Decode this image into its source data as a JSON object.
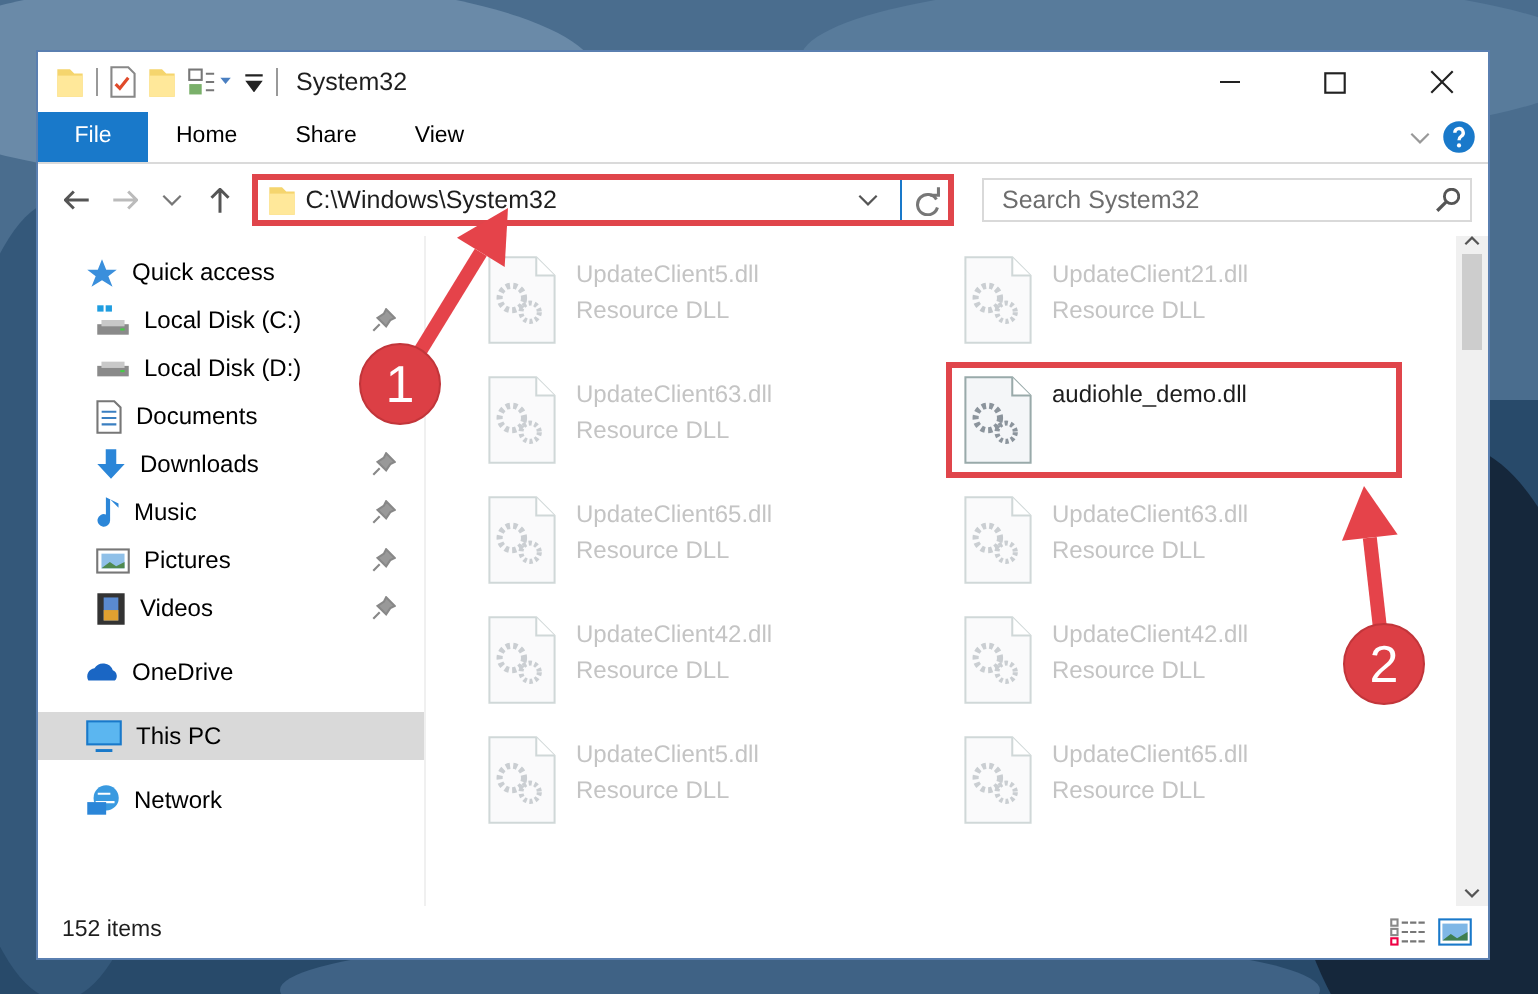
{
  "window": {
    "title": "System32"
  },
  "ribbon_tabs": [
    {
      "label": "File",
      "kind": "menu"
    },
    {
      "label": "Home",
      "kind": "tab"
    },
    {
      "label": "Share",
      "kind": "tab"
    },
    {
      "label": "View",
      "kind": "tab"
    }
  ],
  "address_bar": {
    "path": "C:\\Windows\\System32",
    "highlighted": true
  },
  "search": {
    "placeholder": "Search System32"
  },
  "sidebar": {
    "items": [
      {
        "label": "Quick access",
        "kind": "quick-access",
        "selected": false,
        "children": [
          {
            "label": "Local Disk (C:)",
            "kind": "system-drive",
            "pinned": true,
            "selected": false
          },
          {
            "label": "Local Disk (D:)",
            "kind": "drive",
            "pinned": false,
            "selected": false
          },
          {
            "label": "Documents",
            "kind": "documents",
            "pinned": false,
            "selected": false
          },
          {
            "label": "Downloads",
            "kind": "downloads",
            "pinned": true,
            "selected": false
          },
          {
            "label": "Music",
            "kind": "music",
            "pinned": true,
            "selected": false
          },
          {
            "label": "Pictures",
            "kind": "pictures",
            "pinned": true,
            "selected": false
          },
          {
            "label": "Videos",
            "kind": "videos",
            "pinned": true,
            "selected": false
          }
        ]
      },
      {
        "label": "OneDrive",
        "kind": "cloud",
        "selected": false
      },
      {
        "label": "This PC",
        "kind": "pc",
        "selected": true
      },
      {
        "label": "Network",
        "kind": "network",
        "selected": false
      }
    ]
  },
  "files": [
    {
      "name": "UpdateClient5.dll",
      "type": "Resource DLL",
      "blurred": true,
      "highlighted": false
    },
    {
      "name": "UpdateClient21.dll",
      "type": "Resource DLL",
      "blurred": true,
      "highlighted": false
    },
    {
      "name": "UpdateClient63.dll",
      "type": "Resource DLL",
      "blurred": true,
      "highlighted": false
    },
    {
      "name": "audiohle_demo.dll",
      "blurred": false,
      "highlighted": true
    },
    {
      "name": "UpdateClient65.dll",
      "type": "Resource DLL",
      "blurred": true,
      "highlighted": false
    },
    {
      "name": "UpdateClient63.dll",
      "type": "Resource DLL",
      "blurred": true,
      "highlighted": false
    },
    {
      "name": "UpdateClient42.dll",
      "type": "Resource DLL",
      "blurred": true,
      "highlighted": false
    },
    {
      "name": "UpdateClient42.dll",
      "type": "Resource DLL",
      "blurred": true,
      "highlighted": false
    },
    {
      "name": "UpdateClient5.dll",
      "type": "Resource DLL",
      "blurred": true,
      "highlighted": false
    },
    {
      "name": "UpdateClient65.dll",
      "type": "Resource DLL",
      "blurred": true,
      "highlighted": false
    }
  ],
  "annotations": [
    {
      "label": "1"
    },
    {
      "label": "2"
    }
  ],
  "status_bar": {
    "item_count": "152 items"
  }
}
